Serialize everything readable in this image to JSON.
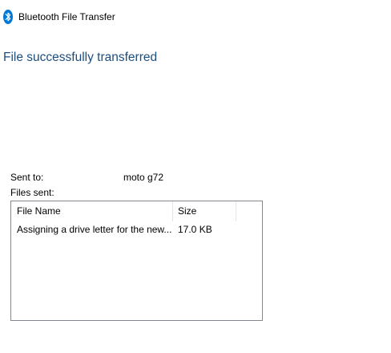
{
  "window": {
    "title": "Bluetooth File Transfer",
    "icon": "bluetooth-icon",
    "accent_color": "#0078d7"
  },
  "status": {
    "heading": "File successfully transferred",
    "heading_color": "#1c4f80"
  },
  "details": {
    "sent_to_label": "Sent to:",
    "sent_to_value": "moto g72",
    "files_sent_label": "Files sent:"
  },
  "files_table": {
    "columns": [
      "File Name",
      "Size"
    ],
    "rows": [
      {
        "name": "Assigning a drive letter for the new...",
        "size": "17.0 KB"
      }
    ]
  }
}
